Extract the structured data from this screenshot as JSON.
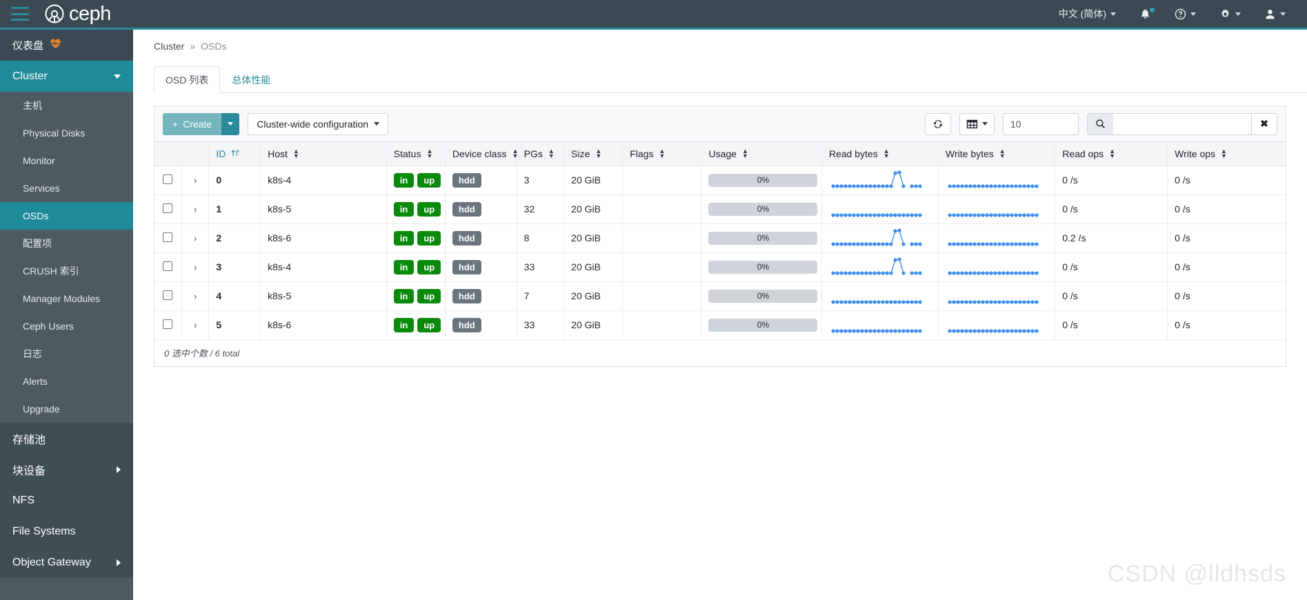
{
  "topbar": {
    "brand": "ceph",
    "menu_icon": "hamburger-icon",
    "language": "中文 (简体)",
    "notifications_icon": "bell-icon",
    "help_icon": "help-circle-icon",
    "settings_icon": "gear-icon",
    "user_icon": "user-icon"
  },
  "sidebar": {
    "dashboard": {
      "label": "仪表盘",
      "icon": "heartbeat-icon"
    },
    "cluster": {
      "label": "Cluster",
      "expanded": true
    },
    "cluster_items": [
      {
        "label": "主机"
      },
      {
        "label": "Physical Disks"
      },
      {
        "label": "Monitor"
      },
      {
        "label": "Services"
      },
      {
        "label": "OSDs",
        "selected": true
      },
      {
        "label": "配置项"
      },
      {
        "label": "CRUSH 索引"
      },
      {
        "label": "Manager Modules"
      },
      {
        "label": "Ceph Users"
      },
      {
        "label": "日志"
      },
      {
        "label": "Alerts"
      },
      {
        "label": "Upgrade"
      }
    ],
    "sections": [
      {
        "label": "存储池",
        "has_chevron": false
      },
      {
        "label": "块设备",
        "has_chevron": true
      },
      {
        "label": "NFS",
        "has_chevron": false
      },
      {
        "label": "File Systems",
        "has_chevron": false
      },
      {
        "label": "Object Gateway",
        "has_chevron": true
      }
    ]
  },
  "breadcrumb": {
    "root": "Cluster",
    "separator": "»",
    "current": "OSDs"
  },
  "tabs": [
    {
      "label": "OSD 列表",
      "active": true
    },
    {
      "label": "总体性能",
      "active": false
    }
  ],
  "toolbar": {
    "create_label": "Create",
    "create_plus": "+",
    "cluster_config_label": "Cluster-wide configuration",
    "refresh_icon": "refresh-icon",
    "columns_icon": "table-columns-icon",
    "limit_value": "10",
    "search_icon": "search-icon",
    "search_value": "",
    "search_placeholder": "",
    "clear_icon": "close-icon"
  },
  "table": {
    "columns": [
      {
        "key": "select",
        "label": ""
      },
      {
        "key": "expand",
        "label": ""
      },
      {
        "key": "id",
        "label": "ID",
        "sorted": true
      },
      {
        "key": "host",
        "label": "Host"
      },
      {
        "key": "status",
        "label": "Status"
      },
      {
        "key": "device_class",
        "label": "Device class"
      },
      {
        "key": "pgs",
        "label": "PGs"
      },
      {
        "key": "size",
        "label": "Size"
      },
      {
        "key": "flags",
        "label": "Flags"
      },
      {
        "key": "usage",
        "label": "Usage"
      },
      {
        "key": "read_bytes",
        "label": "Read bytes"
      },
      {
        "key": "write_bytes",
        "label": "Write bytes"
      },
      {
        "key": "read_ops",
        "label": "Read ops"
      },
      {
        "key": "write_ops",
        "label": "Write ops"
      }
    ],
    "rows": [
      {
        "id": "0",
        "host": "k8s-4",
        "status": [
          "in",
          "up"
        ],
        "device_class": "hdd",
        "pgs": "3",
        "size": "20 GiB",
        "flags": "",
        "usage": "0%",
        "read_ops": "0 /s",
        "write_ops": "0 /s",
        "read_spark": "peak",
        "write_spark": "flat"
      },
      {
        "id": "1",
        "host": "k8s-5",
        "status": [
          "in",
          "up"
        ],
        "device_class": "hdd",
        "pgs": "32",
        "size": "20 GiB",
        "flags": "",
        "usage": "0%",
        "read_ops": "0 /s",
        "write_ops": "0 /s",
        "read_spark": "flat",
        "write_spark": "flat"
      },
      {
        "id": "2",
        "host": "k8s-6",
        "status": [
          "in",
          "up"
        ],
        "device_class": "hdd",
        "pgs": "8",
        "size": "20 GiB",
        "flags": "",
        "usage": "0%",
        "read_ops": "0.2 /s",
        "write_ops": "0 /s",
        "read_spark": "peak",
        "write_spark": "flat"
      },
      {
        "id": "3",
        "host": "k8s-4",
        "status": [
          "in",
          "up"
        ],
        "device_class": "hdd",
        "pgs": "33",
        "size": "20 GiB",
        "flags": "",
        "usage": "0%",
        "read_ops": "0 /s",
        "write_ops": "0 /s",
        "read_spark": "peak",
        "write_spark": "flat"
      },
      {
        "id": "4",
        "host": "k8s-5",
        "status": [
          "in",
          "up"
        ],
        "device_class": "hdd",
        "pgs": "7",
        "size": "20 GiB",
        "flags": "",
        "usage": "0%",
        "read_ops": "0 /s",
        "write_ops": "0 /s",
        "read_spark": "flat",
        "write_spark": "flat"
      },
      {
        "id": "5",
        "host": "k8s-6",
        "status": [
          "in",
          "up"
        ],
        "device_class": "hdd",
        "pgs": "33",
        "size": "20 GiB",
        "flags": "",
        "usage": "0%",
        "read_ops": "0 /s",
        "write_ops": "0 /s",
        "read_spark": "flat",
        "write_spark": "flat"
      }
    ],
    "footer": "0 选中个数 / 6 total"
  },
  "watermark": "CSDN @lldhsds",
  "colors": {
    "topbar_bg": "#3b4a52",
    "accent_teal": "#2b8a9b",
    "sidebar_bg": "#4d5a61",
    "selected_nav": "#1f8a99",
    "status_green": "#0a8a0a",
    "class_gray": "#6c757d",
    "spark_blue": "#3d8ef0"
  }
}
